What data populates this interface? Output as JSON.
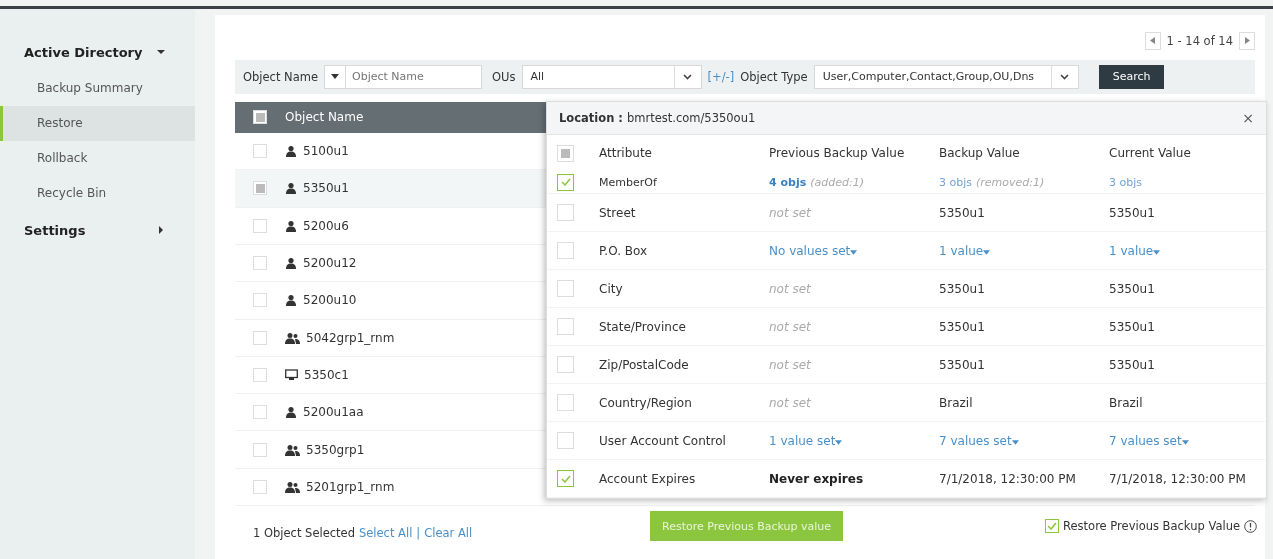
{
  "sidebar": {
    "sections": [
      {
        "label": "Active Directory",
        "expanded": true,
        "items": [
          {
            "label": "Backup Summary",
            "selected": false
          },
          {
            "label": "Restore",
            "selected": true
          },
          {
            "label": "Rollback",
            "selected": false
          },
          {
            "label": "Recycle Bin",
            "selected": false
          }
        ]
      },
      {
        "label": "Settings",
        "expanded": false
      }
    ]
  },
  "pagination": {
    "range": "1 - 14 of 14"
  },
  "filters": {
    "object_name_label": "Object Name",
    "object_name_placeholder": "Object Name",
    "ous_label": "OUs",
    "ous_value": "All",
    "toggle": "[+/-]",
    "object_type_label": "Object Type",
    "object_type_value": "User,Computer,Contact,Group,OU,Dns",
    "search_button": "Search"
  },
  "table": {
    "header_checkbox": {
      "indeterminate": true
    },
    "column": "Object Name",
    "rows": [
      {
        "name": "5100u1",
        "kind": "user",
        "checked": false,
        "selected": false
      },
      {
        "name": "5350u1",
        "kind": "user",
        "checked": true,
        "selected": true
      },
      {
        "name": "5200u6",
        "kind": "user",
        "checked": false,
        "selected": false
      },
      {
        "name": "5200u12",
        "kind": "user",
        "checked": false,
        "selected": false
      },
      {
        "name": "5200u10",
        "kind": "user",
        "checked": false,
        "selected": false
      },
      {
        "name": "5042grp1_rnm",
        "kind": "group",
        "checked": false,
        "selected": false
      },
      {
        "name": "5350c1",
        "kind": "computer",
        "checked": false,
        "selected": false
      },
      {
        "name": "5200u1aa",
        "kind": "user",
        "checked": false,
        "selected": false
      },
      {
        "name": "5350grp1",
        "kind": "group",
        "checked": false,
        "selected": false
      },
      {
        "name": "5201grp1_rnm",
        "kind": "group",
        "checked": false,
        "selected": false
      }
    ]
  },
  "footer": {
    "selected_count": "1 Object Selected",
    "select_all": "Select All",
    "separator": "|",
    "clear_all": "Clear All"
  },
  "details": {
    "location_label": "Location :",
    "location_value": "bmrtest.com/5350ou1",
    "close": "×",
    "header_checkbox": {
      "indeterminate": true
    },
    "columns": [
      "Attribute",
      "Previous Backup Value",
      "Backup Value",
      "Current Value"
    ],
    "rows": [
      {
        "attribute": "MemberOf",
        "checked": true,
        "values": [
          {
            "kind": "objs",
            "text": "4 objs",
            "note": "(added:1)"
          },
          {
            "kind": "objs-light",
            "text": "3 objs",
            "note": "(removed:1)"
          },
          {
            "kind": "objs-light",
            "text": "3 objs"
          }
        ]
      },
      {
        "attribute": "Street",
        "checked": false,
        "values": [
          {
            "kind": "muted",
            "text": "not set"
          },
          {
            "kind": "text",
            "text": "5350u1"
          },
          {
            "kind": "text",
            "text": "5350u1"
          }
        ]
      },
      {
        "attribute": "P.O. Box",
        "checked": false,
        "values": [
          {
            "kind": "dropdown",
            "text": "No values set"
          },
          {
            "kind": "dropdown",
            "text": "1 value"
          },
          {
            "kind": "dropdown",
            "text": "1 value"
          }
        ]
      },
      {
        "attribute": "City",
        "checked": false,
        "values": [
          {
            "kind": "muted",
            "text": "not set"
          },
          {
            "kind": "text",
            "text": "5350u1"
          },
          {
            "kind": "text",
            "text": "5350u1"
          }
        ]
      },
      {
        "attribute": "State/Province",
        "checked": false,
        "values": [
          {
            "kind": "muted",
            "text": "not set"
          },
          {
            "kind": "text",
            "text": "5350u1"
          },
          {
            "kind": "text",
            "text": "5350u1"
          }
        ]
      },
      {
        "attribute": "Zip/PostalCode",
        "checked": false,
        "values": [
          {
            "kind": "muted",
            "text": "not set"
          },
          {
            "kind": "text",
            "text": "5350u1"
          },
          {
            "kind": "text",
            "text": "5350u1"
          }
        ]
      },
      {
        "attribute": "Country/Region",
        "checked": false,
        "values": [
          {
            "kind": "muted",
            "text": "not set"
          },
          {
            "kind": "text",
            "text": "Brazil"
          },
          {
            "kind": "text",
            "text": "Brazil"
          }
        ]
      },
      {
        "attribute": "User Account Control",
        "checked": false,
        "values": [
          {
            "kind": "dropdown",
            "text": "1 value set"
          },
          {
            "kind": "dropdown",
            "text": "7 values set"
          },
          {
            "kind": "dropdown",
            "text": "7 values set"
          }
        ]
      },
      {
        "attribute": "Account Expires",
        "checked": true,
        "values": [
          {
            "kind": "bold",
            "text": "Never expires"
          },
          {
            "kind": "text",
            "text": "7/1/2018, 12:30:00 PM"
          },
          {
            "kind": "text",
            "text": "7/1/2018, 12:30:00 PM"
          }
        ]
      }
    ],
    "restore_button": "Restore Previous Backup value",
    "restore_option": {
      "label": "Restore Previous Backup Value",
      "checked": true
    }
  }
}
